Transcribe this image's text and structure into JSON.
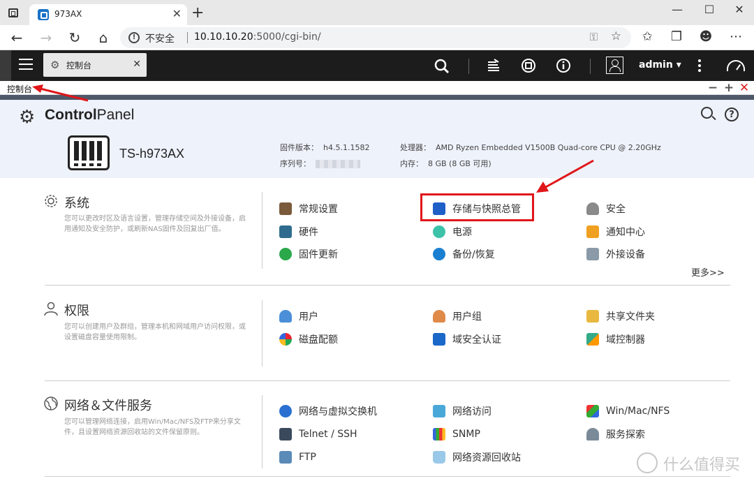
{
  "browser": {
    "tab_title": "973AX",
    "insecure_label": "不安全",
    "url_host": "10.10.10.20",
    "url_rest": ":5000/cgi-bin/"
  },
  "qts": {
    "tab_label": "控制台",
    "user": "admin",
    "window_label": "控制台"
  },
  "control_panel": {
    "title_bold": "Control",
    "title_rest": "Panel",
    "model": "TS-h973AX",
    "firmware_label": "固件版本：",
    "firmware_value": "h4.5.1.1582",
    "serial_label": "序列号：",
    "cpu_label": "处理器：",
    "cpu_value": "AMD Ryzen Embedded V1500B Quad-core CPU @ 2.20GHz",
    "mem_label": "内存：",
    "mem_value": "8 GB (8 GB 可用)"
  },
  "sections": {
    "system": {
      "title": "系统",
      "desc": "您可以更改时区及语言设置，管理存储空间及外接设备，启用通知及安全防护，或刷新NAS固件及回复出厂值。",
      "items": [
        "常规设置",
        "存储与快照总管",
        "安全",
        "硬件",
        "电源",
        "通知中心",
        "固件更新",
        "备份/恢复",
        "外接设备"
      ],
      "more": "更多>>"
    },
    "privilege": {
      "title": "权限",
      "desc": "您可以创建用户及群组，管理本机和网域用户访问权限，或设置磁盘容量使用限制。",
      "items": [
        "用户",
        "用户组",
        "共享文件夹",
        "磁盘配额",
        "域安全认证",
        "域控制器"
      ]
    },
    "network": {
      "title": "网络＆文件服务",
      "desc": "您可以管理网络连接，启用Win/Mac/NFS及FTP来分享文件，且设置网络资源回收站的文件保留原则。",
      "items": [
        "网络与虚拟交换机",
        "网络访问",
        "Win/Mac/NFS",
        "Telnet / SSH",
        "SNMP",
        "服务探索",
        "FTP",
        "网络资源回收站"
      ]
    }
  },
  "watermark": "什么值得买",
  "colors": {
    "highlight": "#e0161a",
    "topbar": "#1c1c1c",
    "header_bg": "#eef2fb"
  }
}
